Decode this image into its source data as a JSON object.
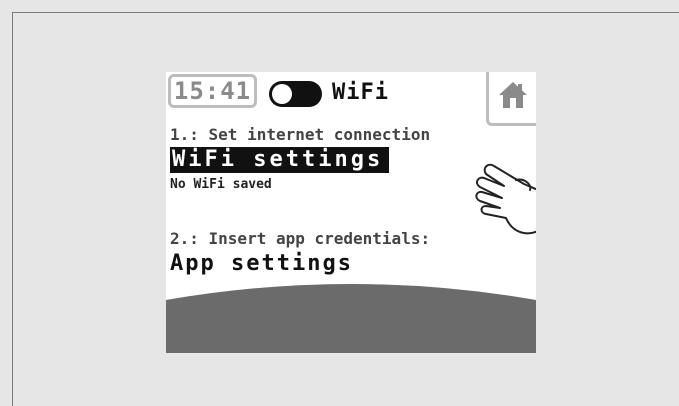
{
  "header": {
    "time": "15:41",
    "wifi_label": "WiFi",
    "wifi_toggle_state": "off",
    "home_icon": "home-icon"
  },
  "main": {
    "step1_label": "1.: Set internet connection",
    "wifi_settings_label": "WiFi settings",
    "wifi_status": "No WiFi saved",
    "step2_label": "2.: Insert app credentials:",
    "app_settings_label": "App settings"
  },
  "overlay": {
    "hand_icon": "pointing-hand-icon"
  },
  "colors": {
    "screen_bg": "#ffffff",
    "frame_bg": "#e6e6e6",
    "highlight_bg": "#111111",
    "footer_band": "#6b6b6b",
    "tab_border": "#bdbdbd"
  }
}
